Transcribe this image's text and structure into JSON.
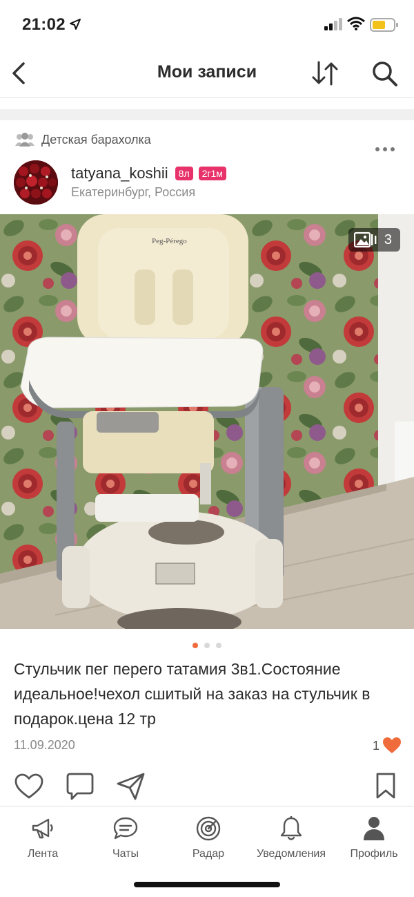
{
  "status_bar": {
    "time": "21:02"
  },
  "header": {
    "title": "Мои записи"
  },
  "post": {
    "group_name": "Детская барахолка",
    "author": {
      "username": "tatyana_koshii",
      "badge_1": "8л",
      "badge_2": "2г1м",
      "location": "Екатеринбург, Россия"
    },
    "photo_count": "3",
    "carousel_active_index": 0,
    "carousel_total": 3,
    "description": "Стульчик пег перего татамия 3в1.Состояние идеальное!чехол сшитый на заказ на стульчик в подарок.цена 12 тр",
    "date": "11.09.2020",
    "like_count": "1"
  },
  "tabs": [
    {
      "label": "Лента",
      "icon": "megaphone-icon"
    },
    {
      "label": "Чаты",
      "icon": "chat-icon"
    },
    {
      "label": "Радар",
      "icon": "radar-icon"
    },
    {
      "label": "Уведомления",
      "icon": "bell-icon"
    },
    {
      "label": "Профиль",
      "icon": "person-icon",
      "active": true
    }
  ],
  "colors": {
    "accent_orange": "#ef6b3c",
    "badge_pink": "#e8336a",
    "text": "#2b2b2b",
    "muted": "#8a8a8a"
  }
}
